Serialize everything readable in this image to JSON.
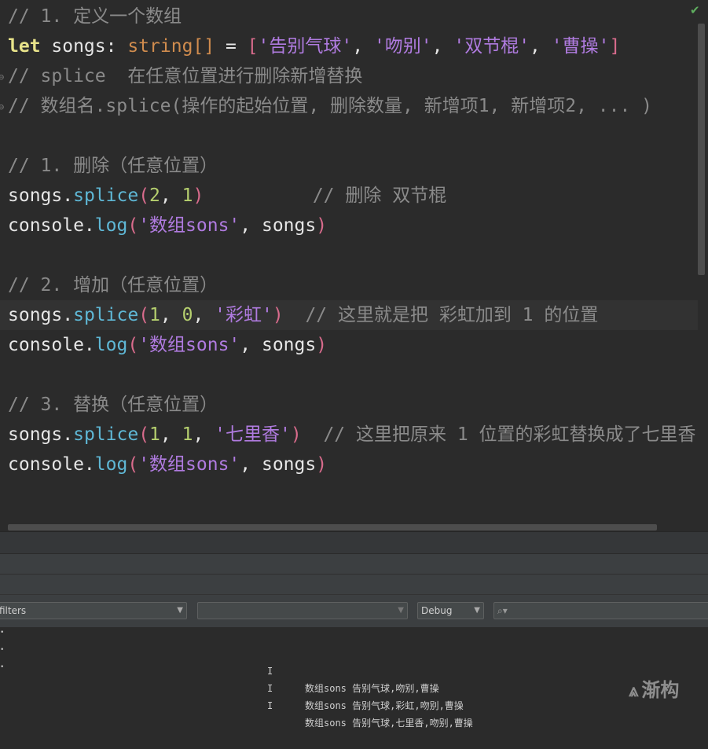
{
  "editor": {
    "status": "✔",
    "lines": {
      "l1": "// 1. 定义一个数组",
      "l2": {
        "kw": "let",
        "name": " songs: ",
        "type": "string",
        "br": "[]",
        "eq": " = ",
        "ob": "[",
        "s1": "'告别气球'",
        "s2": "'吻别'",
        "s3": "'双节棍'",
        "s4": "'曹操'",
        "cb": "]",
        "comma": ", "
      },
      "l3": "// splice  在任意位置进行删除新增替换",
      "l4": "// 数组名.splice(操作的起始位置, 删除数量, 新增项1, 新增项2, ... )",
      "l6": "// 1. 删除（任意位置）",
      "l7": {
        "obj": "songs.",
        "fn": "splice",
        "args1": "2",
        "args2": "1",
        "comment": "// 删除 双节棍"
      },
      "l8": {
        "obj": "console.",
        "fn": "log",
        "str": "'数组sons'",
        "arg": "songs"
      },
      "l10": "// 2. 增加（任意位置）",
      "l11": {
        "obj": "songs.",
        "fn": "splice",
        "a1": "1",
        "a2": "0",
        "str": "'彩虹'",
        "comment": "// 这里就是把 彩虹加到 1 的位置"
      },
      "l12": {
        "obj": "console.",
        "fn": "log",
        "str": "'数组sons'",
        "arg": "songs"
      },
      "l14": "// 3. 替换（任意位置）",
      "l15": {
        "obj": "songs.",
        "fn": "splice",
        "a1": "1",
        "a2": "1",
        "str": "'七里香'",
        "comment": "// 这里把原来 1 位置的彩虹替换成了七里香"
      },
      "l16": {
        "obj": "console.",
        "fn": "log",
        "str": "'数组sons'",
        "arg": "songs"
      }
    }
  },
  "toolbar": {
    "filter_label": "filters",
    "process_value": "",
    "level_value": "Debug",
    "search_placeholder": ""
  },
  "logs": [
    {
      "level": "I",
      "message": "数组sons 告别气球,吻别,曹操"
    },
    {
      "level": "I",
      "message": "数组sons 告别气球,彩虹,吻别,曹操"
    },
    {
      "level": "I",
      "message": "数组sons 告别气球,七里香,吻别,曹操"
    }
  ],
  "watermark": {
    "text": "渐构"
  }
}
